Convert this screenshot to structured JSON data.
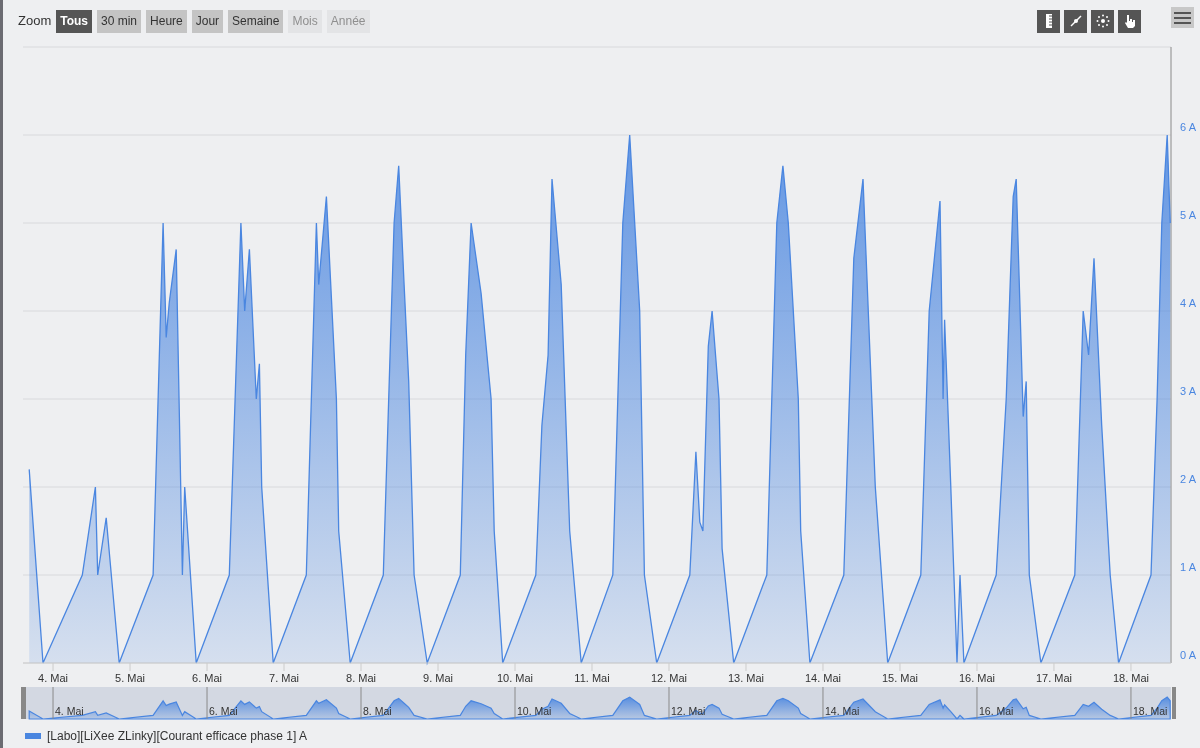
{
  "toolbar": {
    "zoom_label": "Zoom",
    "buttons": [
      {
        "label": "Tous",
        "selected": true,
        "disabled": false
      },
      {
        "label": "30 min",
        "selected": false,
        "disabled": false
      },
      {
        "label": "Heure",
        "selected": false,
        "disabled": false
      },
      {
        "label": "Jour",
        "selected": false,
        "disabled": false
      },
      {
        "label": "Semaine",
        "selected": false,
        "disabled": false
      },
      {
        "label": "Mois",
        "selected": false,
        "disabled": true
      },
      {
        "label": "Année",
        "selected": false,
        "disabled": true
      }
    ]
  },
  "chart": {
    "chart_data": {
      "type": "area",
      "grid": true,
      "xlim": [
        3.61,
        18.52
      ],
      "ylim": [
        0,
        7
      ],
      "xticks": [
        {
          "value": 4,
          "label": "4. Mai"
        },
        {
          "value": 5,
          "label": "5. Mai"
        },
        {
          "value": 6,
          "label": "6. Mai"
        },
        {
          "value": 7,
          "label": "7. Mai"
        },
        {
          "value": 8,
          "label": "8. Mai"
        },
        {
          "value": 9,
          "label": "9. Mai"
        },
        {
          "value": 10,
          "label": "10. Mai"
        },
        {
          "value": 11,
          "label": "11. Mai"
        },
        {
          "value": 12,
          "label": "12. Mai"
        },
        {
          "value": 13,
          "label": "13. Mai"
        },
        {
          "value": 14,
          "label": "14. Mai"
        },
        {
          "value": 15,
          "label": "15. Mai"
        },
        {
          "value": 16,
          "label": "16. Mai"
        },
        {
          "value": 17,
          "label": "17. Mai"
        },
        {
          "value": 18,
          "label": "18. Mai"
        }
      ],
      "yticks": [
        {
          "value": 0,
          "label": "0 A"
        },
        {
          "value": 1,
          "label": "1 A"
        },
        {
          "value": 2,
          "label": "2 A"
        },
        {
          "value": 3,
          "label": "3 A"
        },
        {
          "value": 4,
          "label": "4 A"
        },
        {
          "value": 5,
          "label": "5 A"
        },
        {
          "value": 6,
          "label": "6 A"
        }
      ],
      "x": [
        3.69,
        3.87,
        4.38,
        4.55,
        4.58,
        4.69,
        4.86,
        5.3,
        5.43,
        5.47,
        5.51,
        5.6,
        5.68,
        5.71,
        5.86,
        6.29,
        6.44,
        6.49,
        6.55,
        6.64,
        6.68,
        6.71,
        6.86,
        7.29,
        7.42,
        7.45,
        7.55,
        7.68,
        7.71,
        7.86,
        8.29,
        8.43,
        8.49,
        8.56,
        8.62,
        8.69,
        8.86,
        9.29,
        9.36,
        9.43,
        9.56,
        9.69,
        9.73,
        9.84,
        10.27,
        10.35,
        10.43,
        10.48,
        10.6,
        10.71,
        10.86,
        11.27,
        11.4,
        11.49,
        11.62,
        11.68,
        11.84,
        12.27,
        12.35,
        12.4,
        12.44,
        12.51,
        12.56,
        12.65,
        12.69,
        12.84,
        13.27,
        13.4,
        13.48,
        13.55,
        13.68,
        13.71,
        13.83,
        14.27,
        14.4,
        14.52,
        14.68,
        14.84,
        15.27,
        15.38,
        15.52,
        15.56,
        15.58,
        15.66,
        15.74,
        15.78,
        15.83,
        16.25,
        16.38,
        16.47,
        16.51,
        16.6,
        16.64,
        16.68,
        16.83,
        17.27,
        17.38,
        17.45,
        17.52,
        17.62,
        17.73,
        17.84,
        18.26,
        18.34,
        18.4,
        18.47,
        18.51
      ],
      "series": [
        {
          "name": "[Labo][LiXee ZLinky][Courant efficace phase 1] A",
          "color": "#4a86e0",
          "values": [
            2.2,
            0,
            1,
            2,
            1,
            1.65,
            0,
            1,
            5,
            3.7,
            4.1,
            4.7,
            1,
            2,
            0,
            1,
            5,
            4,
            4.7,
            3,
            3.4,
            2,
            0,
            1,
            5,
            4.3,
            5.3,
            3,
            1.5,
            0,
            1,
            5,
            5.65,
            4.3,
            3.2,
            1,
            0,
            1,
            3.5,
            5,
            4.2,
            3,
            1.5,
            0,
            1,
            2.7,
            3.5,
            5.5,
            4.3,
            1.5,
            0,
            1,
            5,
            6,
            4,
            1,
            0,
            1,
            2.4,
            1.6,
            1.5,
            3.6,
            4,
            3,
            1.3,
            0,
            1,
            5,
            5.65,
            5,
            3,
            1.5,
            0,
            1,
            4.6,
            5.5,
            2,
            0,
            1,
            4,
            5.25,
            3,
            3.9,
            2,
            0,
            1,
            0,
            1,
            3,
            5.3,
            5.5,
            2.8,
            3.2,
            1,
            0,
            1,
            4,
            3.5,
            4.6,
            2.7,
            1,
            0,
            1,
            3,
            5,
            6,
            5
          ]
        }
      ]
    }
  },
  "navigator": {
    "labels": [
      "4. Mai",
      "6. Mai",
      "8. Mai",
      "10. Mai",
      "12. Mai",
      "14. Mai",
      "16. Mai",
      "18. Mai"
    ]
  }
}
